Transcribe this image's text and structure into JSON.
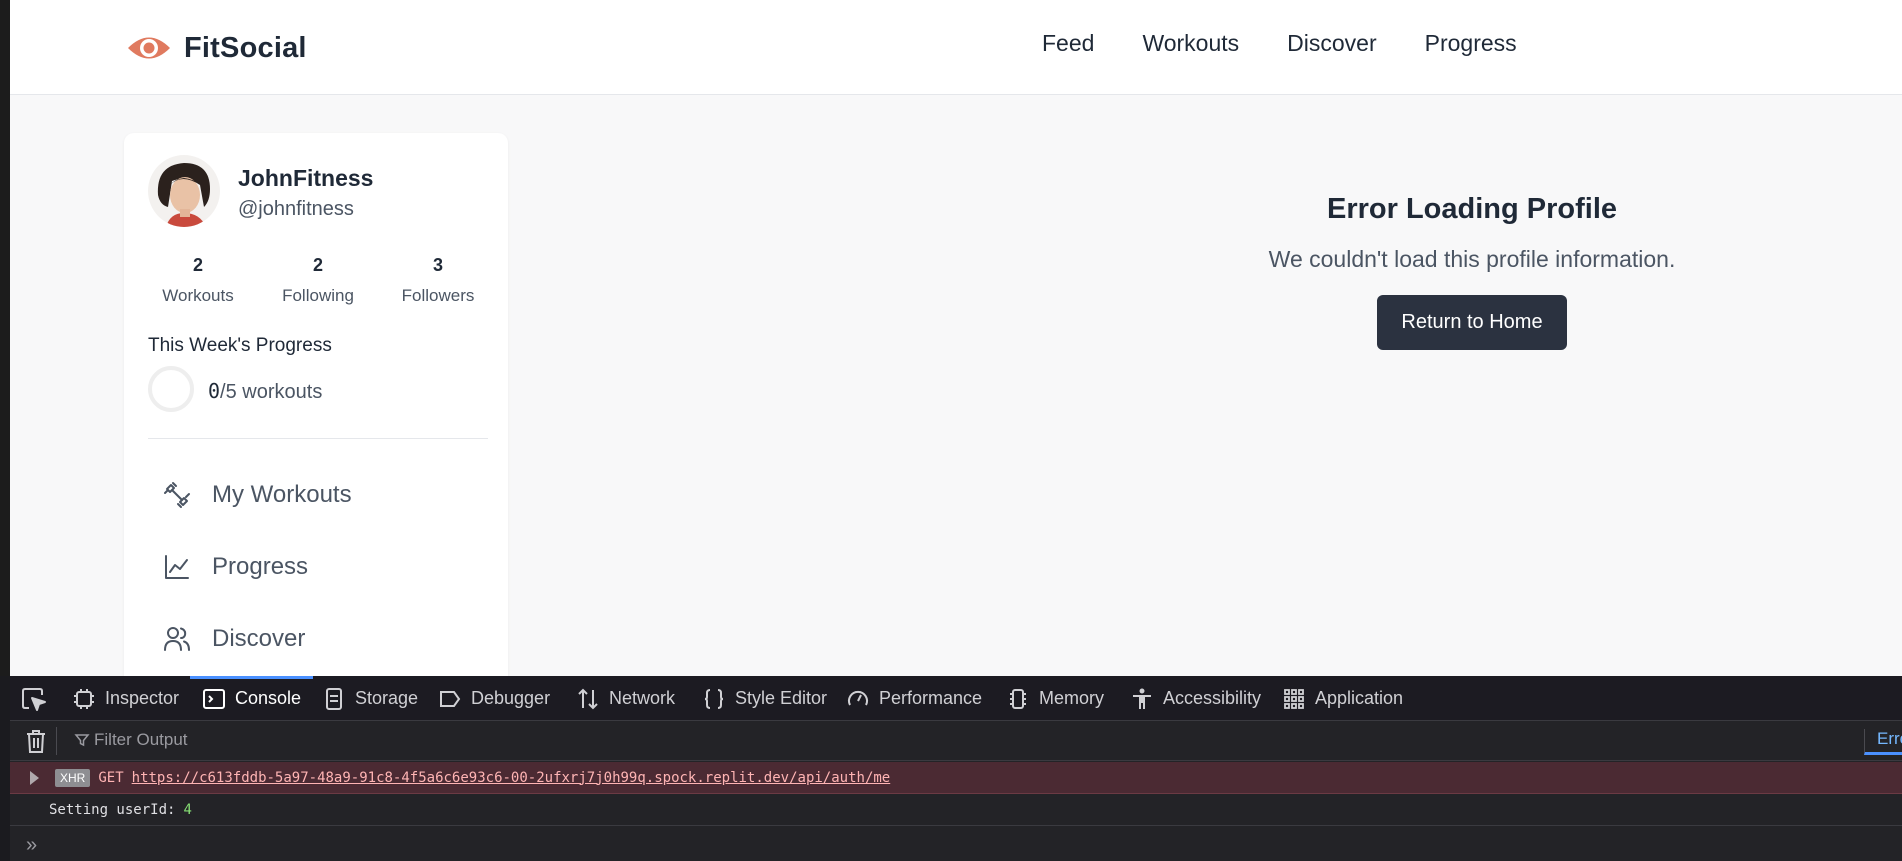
{
  "app": {
    "brand": "FitSocial",
    "brand_color": "#e07a5f",
    "nav": [
      "Feed",
      "Workouts",
      "Discover",
      "Progress"
    ]
  },
  "profile": {
    "name": "JohnFitness",
    "handle": "@johnfitness",
    "stats": [
      {
        "value": "2",
        "label": "Workouts"
      },
      {
        "value": "2",
        "label": "Following"
      },
      {
        "value": "3",
        "label": "Followers"
      }
    ],
    "progress_title": "This Week's Progress",
    "progress_done": "0",
    "progress_rest": "/5 workouts",
    "progress_fraction": 0
  },
  "menu": [
    {
      "label": "My Workouts",
      "icon": "dumbbell-icon"
    },
    {
      "label": "Progress",
      "icon": "chart-line-icon"
    },
    {
      "label": "Discover",
      "icon": "users-icon"
    }
  ],
  "error": {
    "title": "Error Loading Profile",
    "message": "We couldn't load this profile information.",
    "button": "Return to Home"
  },
  "devtools": {
    "tabs": [
      {
        "label": "Inspector",
        "icon": "inspector-icon"
      },
      {
        "label": "Console",
        "icon": "console-icon",
        "active": true
      },
      {
        "label": "Storage",
        "icon": "storage-icon"
      },
      {
        "label": "Debugger",
        "icon": "debugger-icon"
      },
      {
        "label": "Network",
        "icon": "network-icon"
      },
      {
        "label": "Style Editor",
        "icon": "style-editor-icon"
      },
      {
        "label": "Performance",
        "icon": "performance-icon"
      },
      {
        "label": "Memory",
        "icon": "memory-icon"
      },
      {
        "label": "Accessibility",
        "icon": "accessibility-icon"
      },
      {
        "label": "Application",
        "icon": "application-icon"
      }
    ],
    "filter_placeholder": "Filter Output",
    "errors_tab": "Errors",
    "log": {
      "badge": "XHR",
      "method": "GET",
      "url": "https://c613fddb-5a97-48a9-91c8-4f5a6c6e93c6-00-2ufxrj7j0h99q.spock.replit.dev/api/auth/me",
      "message": "Setting userId:",
      "value": "4"
    }
  }
}
